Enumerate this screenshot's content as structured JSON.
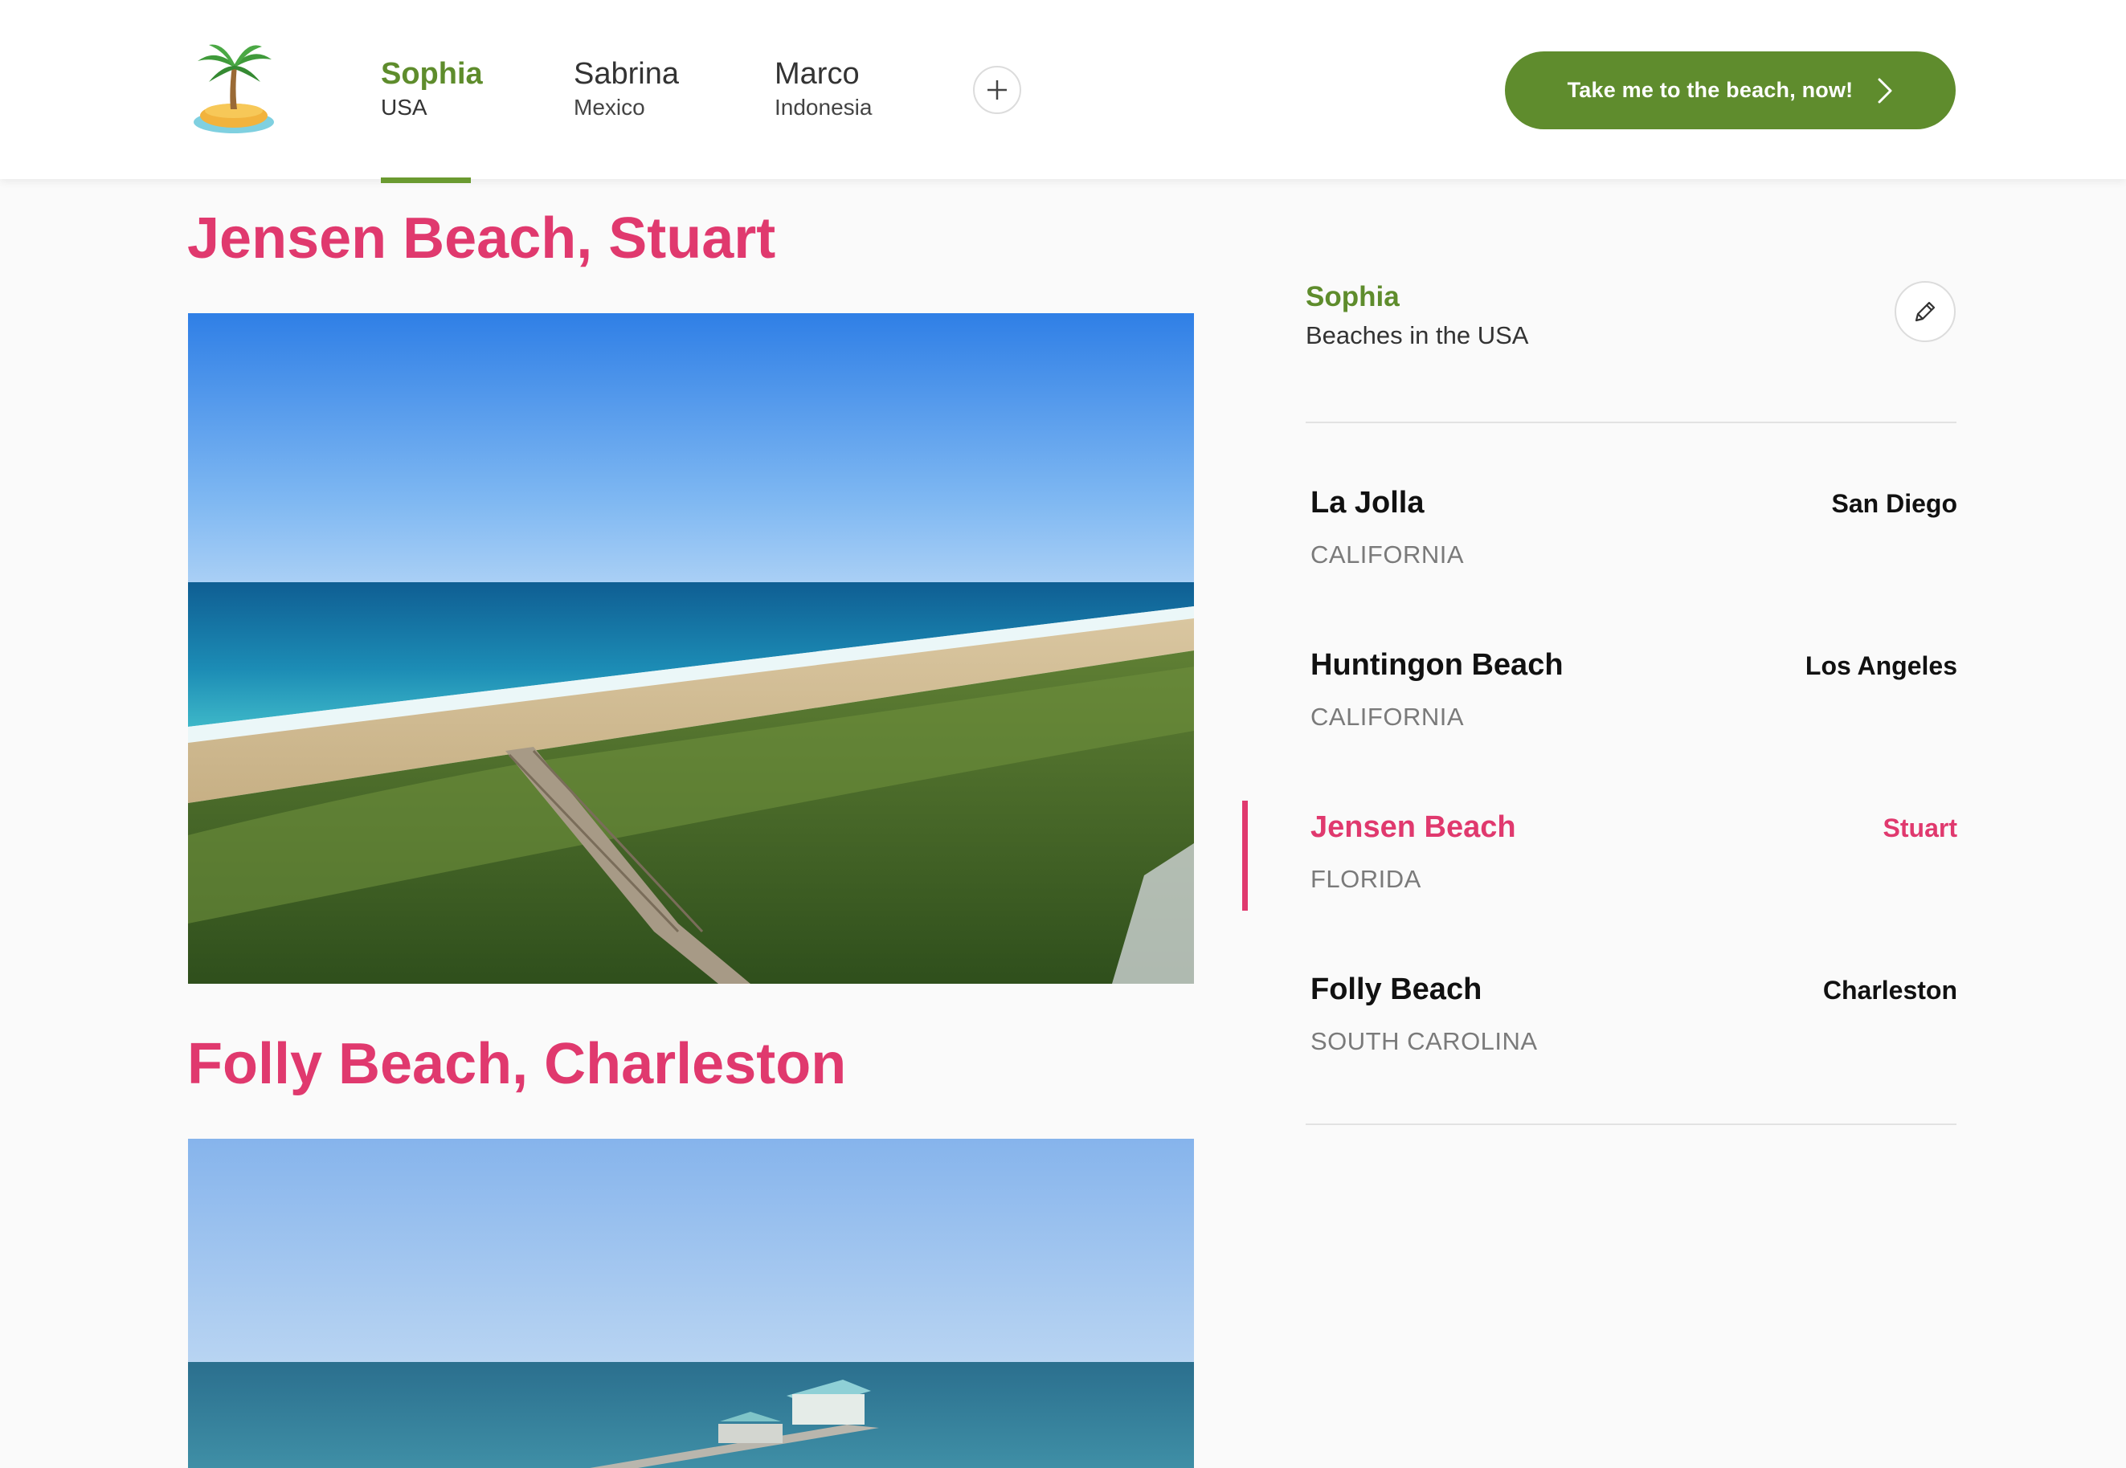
{
  "colors": {
    "brand_green": "#5f8c2d",
    "accent_pink": "#e0396e",
    "background": "#fafafa"
  },
  "header": {
    "logo_icon": "palm-island-icon",
    "tabs": [
      {
        "name": "Sophia",
        "country": "USA",
        "active": true
      },
      {
        "name": "Sabrina",
        "country": "Mexico",
        "active": false
      },
      {
        "name": "Marco",
        "country": "Indonesia",
        "active": false
      }
    ],
    "add_tab_icon": "plus-icon",
    "cta_label": "Take me to the beach, now!",
    "cta_icon": "chevron-right-icon"
  },
  "main": {
    "sections": [
      {
        "title": "Jensen Beach, Stuart"
      },
      {
        "title": "Folly Beach, Charleston"
      }
    ]
  },
  "sidebar": {
    "profile_name": "Sophia",
    "profile_subtitle": "Beaches in the USA",
    "edit_icon": "pencil-icon",
    "beaches": [
      {
        "name": "La Jolla",
        "city": "San Diego",
        "state": "CALIFORNIA",
        "active": false
      },
      {
        "name": "Huntingon Beach",
        "city": "Los Angeles",
        "state": "CALIFORNIA",
        "active": false
      },
      {
        "name": "Jensen Beach",
        "city": "Stuart",
        "state": "FLORIDA",
        "active": true
      },
      {
        "name": "Folly Beach",
        "city": "Charleston",
        "state": "SOUTH CAROLINA",
        "active": false
      }
    ]
  }
}
